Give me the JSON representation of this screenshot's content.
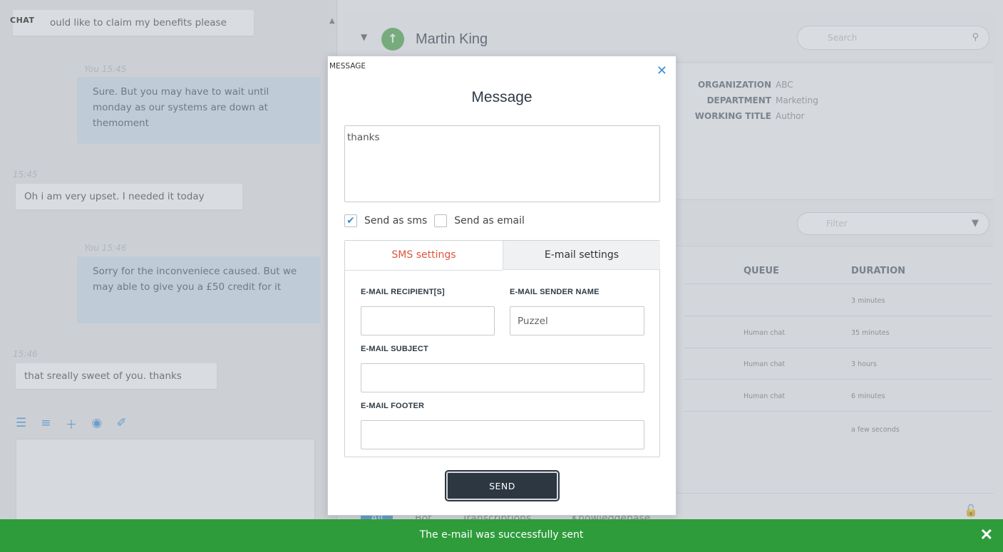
{
  "chat": {
    "tag": "CHAT",
    "messages": [
      {
        "meta": "",
        "text": "ould like to claim my benefits please"
      },
      {
        "meta": "You 15:45",
        "text": "Sure. But you may have to wait until monday as our systems are down at themoment"
      },
      {
        "meta": "15:45",
        "text": "Oh i am very upset. I needed it today"
      },
      {
        "meta": "You 15:46",
        "text": "Sorry for the inconveniece caused. But we may able to give you a £50 credit for it"
      },
      {
        "meta": "15:46",
        "text": "that sreally sweet of you. thanks"
      }
    ],
    "toolbar_icons": [
      "list-icon",
      "checklist-icon",
      "plus-icon",
      "eye-icon",
      "paperclip-icon"
    ]
  },
  "contact": {
    "name": "Martin King",
    "search_placeholder": "Search",
    "info": [
      {
        "label": "ORGANIZATION",
        "value": "ABC"
      },
      {
        "label": "DEPARTMENT",
        "value": "Marketing"
      },
      {
        "label": "WORKING TITLE",
        "value": "Author"
      }
    ]
  },
  "history": {
    "filter_placeholder": "Filter",
    "columns": [
      "QUEUE",
      "DURATION"
    ],
    "rows": [
      {
        "queue": "",
        "duration": "3 minutes"
      },
      {
        "queue": "Human chat",
        "duration": "35 minutes"
      },
      {
        "queue": "Human chat",
        "duration": "3 hours"
      },
      {
        "queue": "Human chat",
        "duration": "6 minutes"
      },
      {
        "queue": "",
        "duration": "a few seconds"
      }
    ]
  },
  "bottom_tabs": [
    "All",
    "Bot",
    "Transcriptions",
    "Knowledgebase"
  ],
  "modal": {
    "tag": "MESSAGE",
    "title": "Message",
    "message_value": "thanks",
    "send_as_sms_label": "Send as sms",
    "send_as_sms_checked": true,
    "send_as_email_label": "Send as email",
    "send_as_email_checked": false,
    "tab_sms": "SMS settings",
    "tab_email": "E-mail settings",
    "recipient_label": "E-MAIL RECIPIENT[S]",
    "recipient_value": "",
    "sender_label": "E-MAIL SENDER NAME",
    "sender_value": "Puzzel",
    "subject_label": "E-MAIL SUBJECT",
    "subject_value": "",
    "footer_label": "E-MAIL FOOTER",
    "footer_value": "",
    "send_label": "SEND"
  },
  "toast": {
    "text": "The e-mail was successfully sent"
  },
  "colors": {
    "accent": "#3b8fd8",
    "toast_green": "#2e9c3b",
    "sms_tab_active": "#e0533f",
    "send_button": "#2c3742"
  }
}
